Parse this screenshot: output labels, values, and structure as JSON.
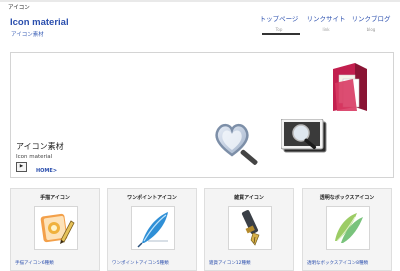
{
  "header": {
    "tagline": "アイコン",
    "site_title": "Icon material",
    "site_subtitle": "アイコン素材"
  },
  "nav": [
    {
      "label": "トップページ",
      "sub": "Top",
      "active": true
    },
    {
      "label": "リンクサイト",
      "sub": "link",
      "active": false
    },
    {
      "label": "リンクブログ",
      "sub": "blog",
      "active": false
    }
  ],
  "hero": {
    "title": "アイコン素材",
    "subtitle": "Icon material",
    "play_symbol": "▶",
    "link": "HOME>"
  },
  "cards": [
    {
      "title": "手描アイコン",
      "link": "手描アイコン6種類",
      "icon": "handdrawn-pencil-icon"
    },
    {
      "title": "ワンポイントアイコン",
      "link": "ワンポイントアイコン5種類",
      "icon": "feather-quill-icon"
    },
    {
      "title": "雑貨アイコン",
      "link": "雑貨アイコン12種類",
      "icon": "fountain-pen-icon"
    },
    {
      "title": "透明なボックスアイコン",
      "link": "透明なボックスアイコン8種類",
      "icon": "translucent-box-icon"
    }
  ],
  "colors": {
    "accent_blue": "#2b4fae",
    "card_bg": "#f4f4f4",
    "border": "#d4d4d4"
  }
}
